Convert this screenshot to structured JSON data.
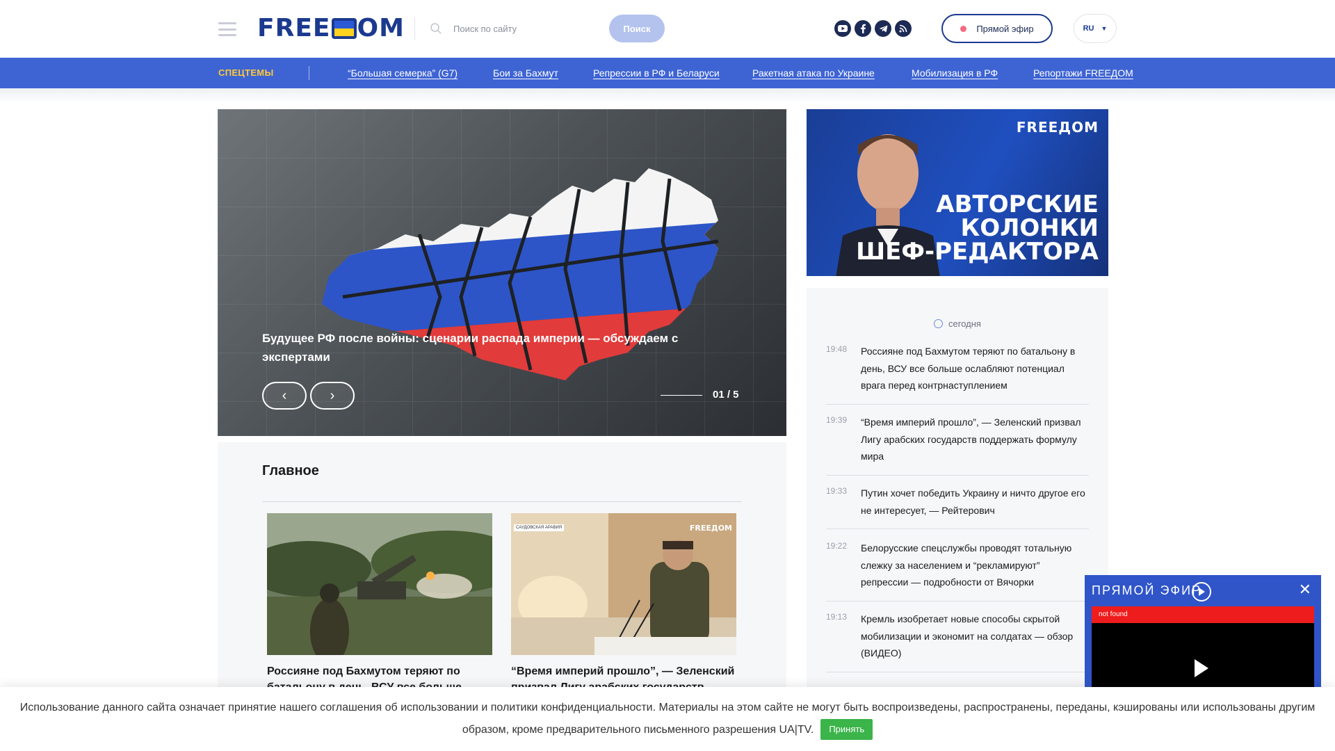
{
  "header": {
    "logo": "FREEДOM",
    "search_placeholder": "Поиск по сайту",
    "search_button": "Поиск",
    "live_button": "Прямой эфир",
    "lang": "RU",
    "social_icons": [
      "youtube-icon",
      "facebook-icon",
      "telegram-icon",
      "rss-icon"
    ]
  },
  "specnav": {
    "label": "СПЕЦТЕМЫ",
    "links": [
      "“Большая семерка” (G7)",
      "Бои за Бахмут",
      "Репрессии в РФ и Беларуси",
      "Ракетная атака по Украине",
      "Мобилизация в РФ",
      "Репортажи FREEДOM"
    ]
  },
  "hero": {
    "title": "Будущее РФ после войны: сценарии распада империи — обсуждаем с экспертами",
    "counter": "01 / 5"
  },
  "main": {
    "title": "Главное",
    "cards": [
      {
        "title": "Россияне под Бахмутом теряют по батальону в день, ВСУ все больше"
      },
      {
        "title": "“Время империй прошло”, — Зеленский призвал Лигу арабских государств",
        "image_tag": "САУДОВСКАЯ АРАВИЯ",
        "image_logo": "FREEДOM"
      }
    ]
  },
  "ad": {
    "logo": "FREEДOM",
    "lines": [
      "АВТОРСКИЕ",
      "КОЛОНКИ",
      "ШЕФ-РЕДАКТОРА"
    ]
  },
  "feed": {
    "today": "сегодня",
    "items": [
      {
        "time": "19:48",
        "text": "Россияне под Бахмутом теряют по батальону в день, ВСУ все больше ослабляют потенциал врага перед контрнаступлением"
      },
      {
        "time": "19:39",
        "text": "“Время империй прошло”, — Зеленский призвал Лигу арабских государств поддержать формулу мира"
      },
      {
        "time": "19:33",
        "text": "Путин хочет победить Украину и ничто другое его не интересует, — Рейтерович"
      },
      {
        "time": "19:22",
        "text": "Белорусские спецслужбы проводят тотальную слежку за населением и “рекламируют” репрессии — подробности от Вячорки"
      },
      {
        "time": "19:13",
        "text": "Кремль изобретает новые способы скрытой мобилизации и экономит на солдатах — обзор (ВИДЕО)"
      }
    ]
  },
  "player": {
    "title": "ПРЯМОЙ ЭФИР",
    "error": "not found"
  },
  "cookie": {
    "text": "Использование данного сайта означает принятие нашего соглашения об использовании и политики конфиденциальности. Материалы на этом сайте не могут быть воспроизведены, распространены, переданы, кэшированы или использованы другим образом, кроме предварительного письменного разрешения UA|TV.",
    "button": "Принять"
  },
  "colors": {
    "brand_blue": "#3e64d4",
    "logo_blue": "#1b3a8f",
    "spec_label": "#ffc93a",
    "cookie_button": "#3bb44a",
    "player_error": "#ee1c1c"
  }
}
